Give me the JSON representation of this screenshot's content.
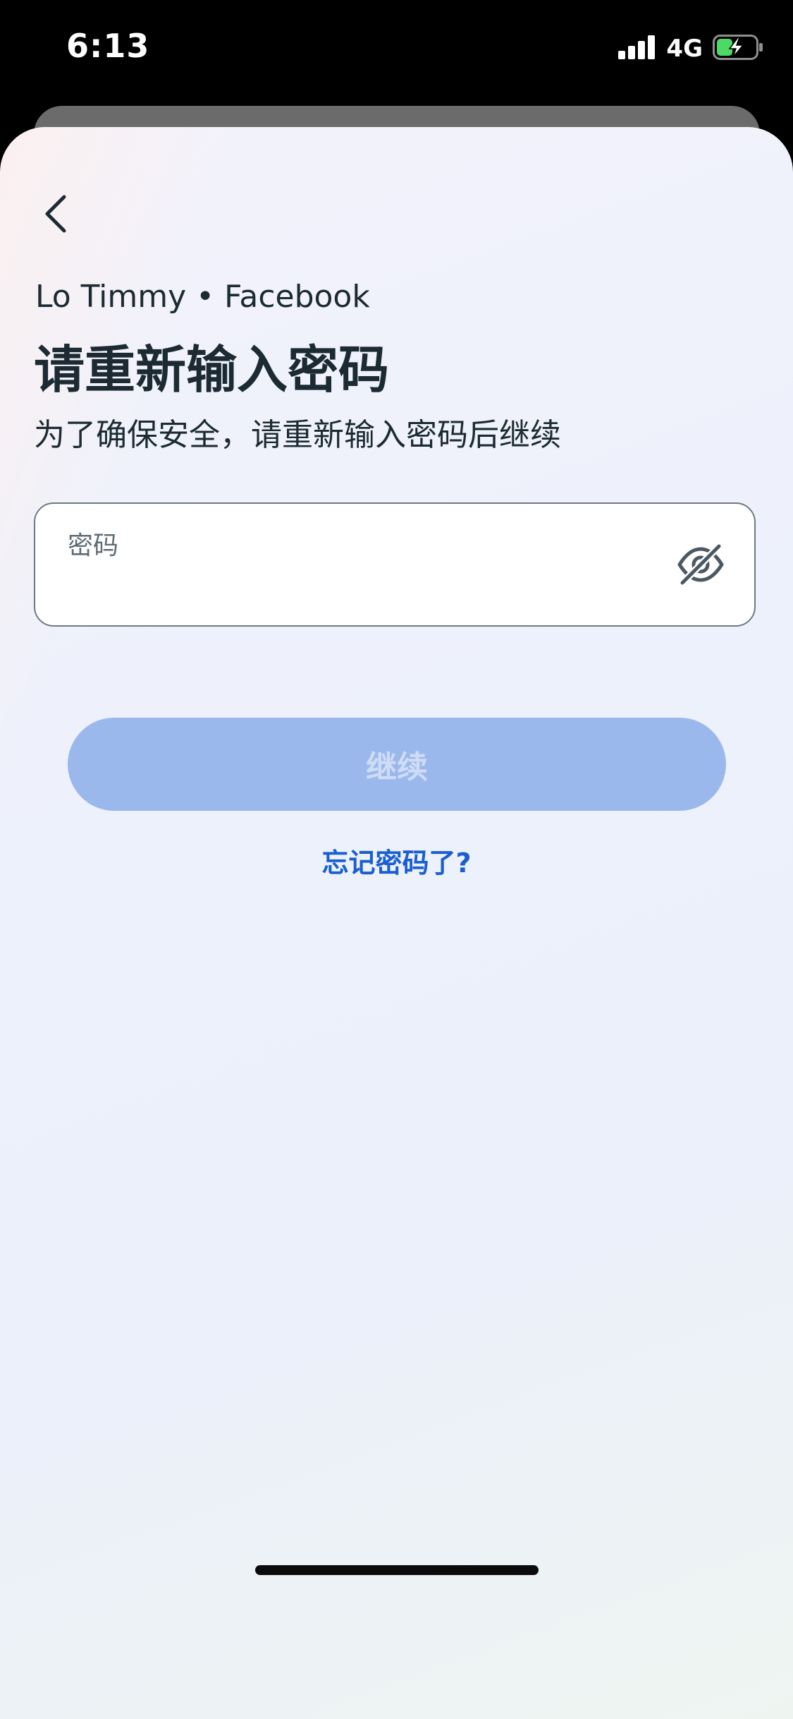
{
  "status_bar": {
    "time": "6:13",
    "network": "4G",
    "signal_icon": "signal-bars-icon",
    "battery_icon": "battery-charging-icon",
    "battery_color": "#4cd964"
  },
  "header": {
    "back_icon": "chevron-left-icon"
  },
  "main": {
    "account": "Lo Timmy • Facebook",
    "title": "请重新输入密码",
    "subtitle": "为了确保安全，请重新输入密码后继续",
    "password_field": {
      "label": "密码",
      "value": "",
      "toggle_icon": "eye-off-icon"
    },
    "continue_label": "继续",
    "forgot_link": "忘记密码了?"
  },
  "colors": {
    "text_primary": "#1c2b33",
    "button_disabled_bg": "#9bb8ec",
    "link": "#1a5fd0"
  }
}
